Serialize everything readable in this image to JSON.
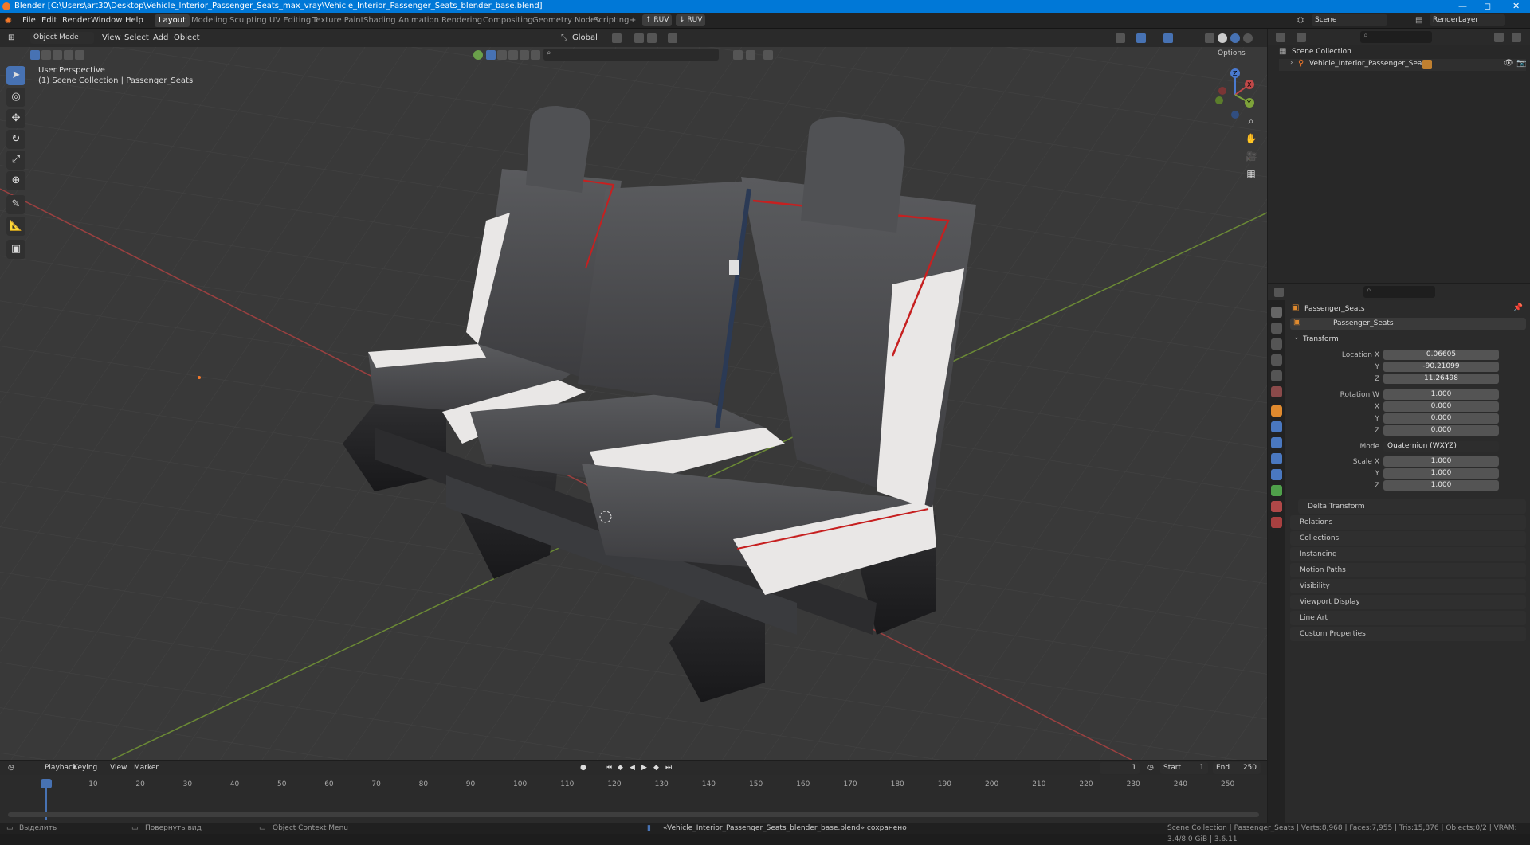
{
  "title_bar": {
    "text": "Blender [C:\\Users\\art30\\Desktop\\Vehicle_Interior_Passenger_Seats_max_vray\\Vehicle_Interior_Passenger_Seats_blender_base.blend]",
    "minimize": "—",
    "maximize": "◻",
    "close": "✕"
  },
  "menu": {
    "file": "File",
    "edit": "Edit",
    "render": "Render",
    "window": "Window",
    "help": "Help"
  },
  "workspaces": [
    "Layout",
    "Modeling",
    "Sculpting",
    "UV Editing",
    "Texture Paint",
    "Shading",
    "Animation",
    "Rendering",
    "Compositing",
    "Geometry Nodes",
    "Scripting"
  ],
  "workspace_add": "+",
  "ruv_buttons": [
    "↑ RUV",
    "↓ RUV"
  ],
  "scene": {
    "name": "Scene",
    "view_layer": "RenderLayer"
  },
  "viewport": {
    "mode": "Object Mode",
    "menus": [
      "View",
      "Select",
      "Add",
      "Object"
    ],
    "transform_orientation": "Global",
    "options": "Options",
    "info_line1": "User Perspective",
    "info_line2": "(1) Scene Collection | Passenger_Seats",
    "gizmo": {
      "x": "X",
      "y": "Y",
      "z": "Z"
    }
  },
  "tools": [
    "select-box",
    "cursor",
    "move",
    "rotate",
    "scale",
    "transform",
    "annotate",
    "measure",
    "add-cube"
  ],
  "outliner": {
    "root": "Scene Collection",
    "items": [
      {
        "label": "Vehicle_Interior_Passenger_Seats"
      }
    ]
  },
  "properties": {
    "object_name": "Passenger_Seats",
    "data_name": "Passenger_Seats",
    "transform_title": "Transform",
    "location": {
      "label": "Location X",
      "x": "0.06605",
      "y": "-90.21099",
      "z": "11.26498"
    },
    "rotation": {
      "label": "Rotation W",
      "w": "1.000",
      "x": "0.000",
      "y": "0.000",
      "z": "0.000"
    },
    "mode_label": "Mode",
    "mode_value": "Quaternion (WXYZ)",
    "scale": {
      "label": "Scale X",
      "x": "1.000",
      "y": "1.000",
      "z": "1.000"
    },
    "axis_labels": {
      "y": "Y",
      "z": "Z",
      "x": "X"
    },
    "panels": [
      "Delta Transform",
      "Relations",
      "Collections",
      "Instancing",
      "Motion Paths",
      "Visibility",
      "Viewport Display",
      "Line Art",
      "Custom Properties"
    ]
  },
  "timeline": {
    "menus": [
      "Playback",
      "Keying",
      "View",
      "Marker"
    ],
    "current_frame": "1",
    "start_label": "Start",
    "start": "1",
    "end_label": "End",
    "end": "250",
    "ticks": [
      "1",
      "10",
      "20",
      "30",
      "40",
      "50",
      "60",
      "70",
      "80",
      "90",
      "100",
      "110",
      "120",
      "130",
      "140",
      "150",
      "160",
      "170",
      "180",
      "190",
      "200",
      "210",
      "220",
      "230",
      "240",
      "250"
    ]
  },
  "status_bar": {
    "left1": "Выделить",
    "left2": "Повернуть вид",
    "left3": "Object Context Menu",
    "message": "«Vehicle_Interior_Passenger_Seats_blender_base.blend» сохранено",
    "stats": "Scene Collection | Passenger_Seats | Verts:8,968 | Faces:7,955 | Tris:15,876 | Objects:0/2 | VRAM: 3.4/8.0 GiB | 3.6.11"
  },
  "colors": {
    "accent": "#4772b3",
    "title_bar": "#0078d7",
    "viewport_bg": "#393939",
    "axis_x": "#c04848",
    "axis_y": "#7ea33a",
    "seat_dark": "#4a4a4d",
    "seat_light": "#e9e7e6",
    "seam_red": "#c62020"
  }
}
